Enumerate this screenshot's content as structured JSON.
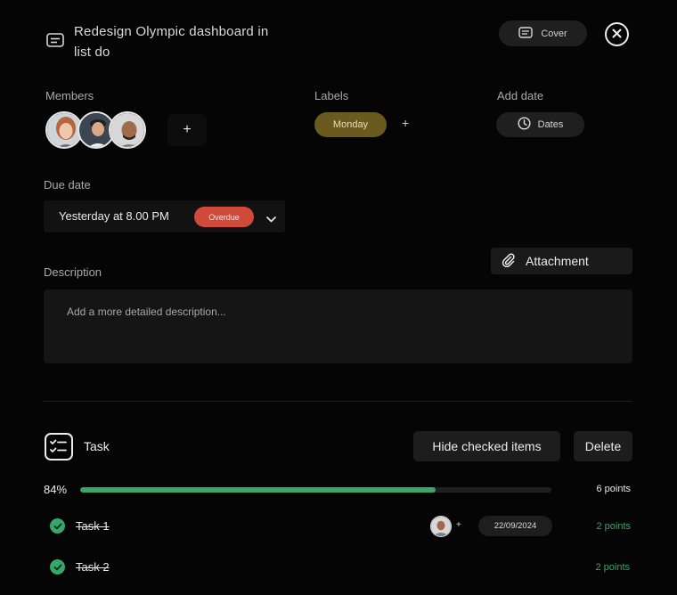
{
  "card": {
    "title": "Redesign Olympic dashboard in list do",
    "cover_label": "Cover",
    "icons": {
      "card": "card-icon",
      "cover": "image-card-icon",
      "close": "close-icon"
    }
  },
  "members": {
    "label": "Members",
    "avatars": [
      "member-avatar-1",
      "member-avatar-2",
      "member-avatar-3"
    ],
    "add_label": "+"
  },
  "labels": {
    "label": "Labels",
    "items": [
      {
        "name": "Monday",
        "color": "#6b5a1e"
      }
    ],
    "add_label": "+"
  },
  "add_date": {
    "label": "Add date",
    "button_label": "Dates",
    "icon": "clock-icon"
  },
  "due_date": {
    "label": "Due date",
    "value": "Yesterday at 8.00 PM",
    "status": "Overdue",
    "status_color": "#cf4a3b",
    "icon": "chevron-down-icon"
  },
  "attachment": {
    "label": "Attachment",
    "icon": "paperclip-icon"
  },
  "description": {
    "label": "Description",
    "placeholder": "Add a more detailed description..."
  },
  "checklist": {
    "title": "Task",
    "icon": "checklist-icon",
    "hide_label": "Hide checked items",
    "delete_label": "Delete",
    "progress_text": "84%",
    "progress": 0.755,
    "progress_color": "#3fa46b",
    "total_points": "6 points",
    "items": [
      {
        "name": "Task 1",
        "checked": true,
        "date": "22/09/2024",
        "assign_add": "+",
        "points": "2 points"
      },
      {
        "name": "Task 2",
        "checked": true,
        "points": "2 points"
      }
    ]
  }
}
